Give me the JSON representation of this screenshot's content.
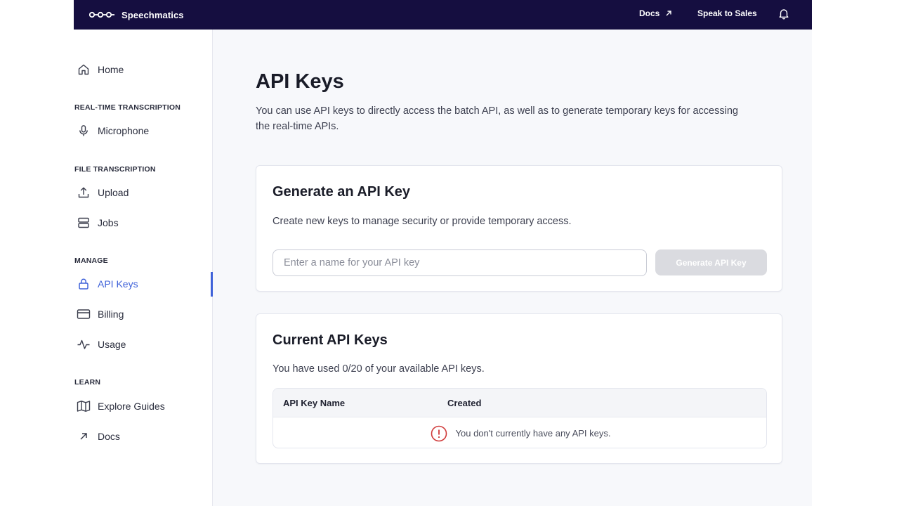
{
  "header": {
    "brand": "Speechmatics",
    "docs_label": "Docs",
    "sales_label": "Speak to Sales"
  },
  "sidebar": {
    "home": "Home",
    "sections": {
      "realtime": "REAL-TIME TRANSCRIPTION",
      "file": "FILE TRANSCRIPTION",
      "manage": "MANAGE",
      "learn": "LEARN"
    },
    "items": {
      "microphone": "Microphone",
      "upload": "Upload",
      "jobs": "Jobs",
      "api_keys": "API Keys",
      "billing": "Billing",
      "usage": "Usage",
      "explore_guides": "Explore Guides",
      "docs": "Docs"
    },
    "active_item": "API Keys",
    "accent_color": "#3f62d9"
  },
  "main": {
    "title": "API Keys",
    "description": "You can use API keys to directly access the batch API, as well as to generate temporary keys for accessing the real-time APIs.",
    "generate_card": {
      "title": "Generate an API Key",
      "subtitle": "Create new keys to manage security or provide temporary access.",
      "input_value": "",
      "input_placeholder": "Enter a name for your API key",
      "button_label": "Generate API Key"
    },
    "current_card": {
      "title": "Current API Keys",
      "usage_text": "You have used 0/20 of your available API keys.",
      "columns": [
        "API Key Name",
        "Created"
      ],
      "empty_message": "You don't currently have any API keys."
    }
  }
}
